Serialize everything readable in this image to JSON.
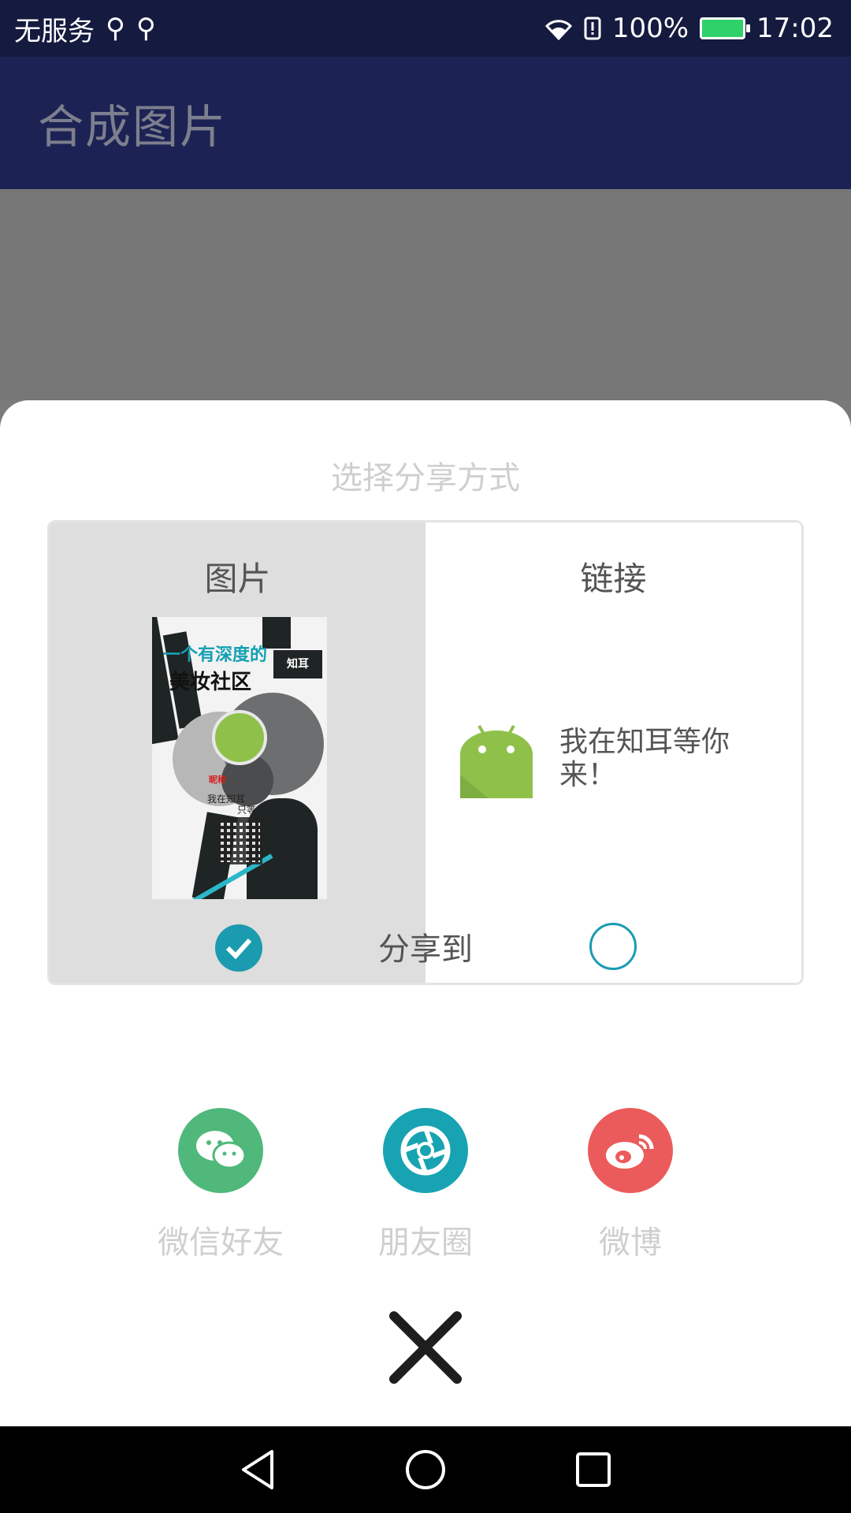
{
  "status_bar": {
    "carrier": "无服务",
    "battery": "100%",
    "time": "17:02"
  },
  "app_bar": {
    "title": "合成图片"
  },
  "sheet": {
    "title": "选择分享方式",
    "options": [
      {
        "label": "图片",
        "selected": true
      },
      {
        "label": "链接",
        "selected": false
      }
    ],
    "poster": {
      "line1": "一个有深度的",
      "line2": "美妆社区",
      "logo": "知耳",
      "nickname": "昵称",
      "text1": "我在知耳",
      "text2": "只等你来"
    },
    "link_text": "我在知耳等你来！",
    "share_label": "分享到",
    "share_targets": [
      {
        "label": "微信好友",
        "color": "#4fb87a",
        "icon": "wechat-icon"
      },
      {
        "label": "朋友圈",
        "color": "#17a3b1",
        "icon": "moments-icon"
      },
      {
        "label": "微博",
        "color": "#ec5b5b",
        "icon": "weibo-icon"
      }
    ]
  }
}
